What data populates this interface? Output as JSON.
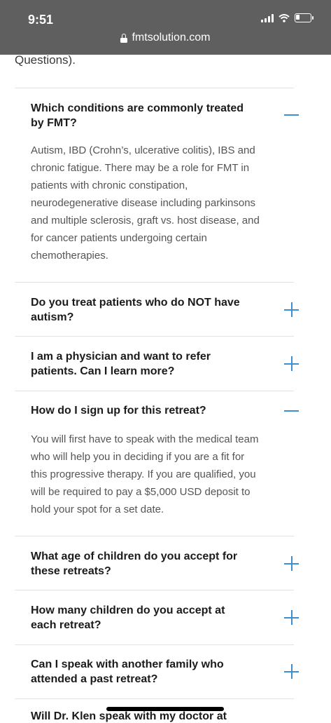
{
  "status_bar": {
    "time": "9:51",
    "url": "fmtsolution.com",
    "icons": [
      "signal-icon",
      "wifi-icon",
      "battery-icon",
      "lock-icon"
    ]
  },
  "page": {
    "prev_text": "Questions).",
    "faqs": [
      {
        "question_lines": [
          "Which conditions are commonly treated",
          "by FMT?"
        ],
        "expanded": true,
        "answer_lines": [
          "Autism, IBD (Crohn’s, ulcerative colitis), IBS and",
          "chronic fatigue. There may be a role for FMT in",
          "patients with chronic constipation,",
          "neurodegenerative disease including parkinsons",
          "and multiple sclerosis, graft vs. host disease, and",
          "for cancer patients undergoing certain",
          "chemotherapies."
        ]
      },
      {
        "question_lines": [
          "Do you treat patients who do NOT have",
          "autism?"
        ],
        "expanded": false
      },
      {
        "question_lines": [
          "I am a physician and want to refer",
          "patients. Can I learn more?"
        ],
        "expanded": false
      },
      {
        "question_lines": [
          "How do I sign up for this retreat?"
        ],
        "expanded": true,
        "answer_lines": [
          "You will first have to speak with the medical team",
          "who will help you in deciding if you are a fit for",
          "this progressive therapy. If you are qualified, you",
          "will be required to pay a $5,000 USD deposit to",
          "hold your spot for a set date."
        ]
      },
      {
        "question_lines": [
          "What age of children do you accept for",
          "these retreats?"
        ],
        "expanded": false
      },
      {
        "question_lines": [
          "How many children do you accept at",
          "each retreat?"
        ],
        "expanded": false
      },
      {
        "question_lines": [
          "Can I speak with another family who",
          "attended a past retreat?"
        ],
        "expanded": false
      }
    ],
    "bottom_peek": "Will Dr. Klen speak with my doctor at"
  },
  "colors": {
    "accent": "#3f8fd0",
    "status_bar": "#5f5f5f",
    "question_text": "#1b1b1b",
    "answer_text": "#555555"
  }
}
